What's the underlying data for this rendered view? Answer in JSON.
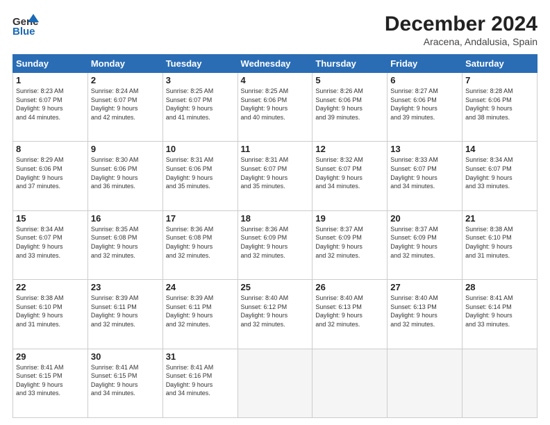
{
  "header": {
    "logo_line1": "General",
    "logo_line2": "Blue",
    "month_year": "December 2024",
    "location": "Aracena, Andalusia, Spain"
  },
  "weekdays": [
    "Sunday",
    "Monday",
    "Tuesday",
    "Wednesday",
    "Thursday",
    "Friday",
    "Saturday"
  ],
  "weeks": [
    [
      {
        "day": 1,
        "lines": [
          "Sunrise: 8:23 AM",
          "Sunset: 6:07 PM",
          "Daylight: 9 hours",
          "and 44 minutes."
        ]
      },
      {
        "day": 2,
        "lines": [
          "Sunrise: 8:24 AM",
          "Sunset: 6:07 PM",
          "Daylight: 9 hours",
          "and 42 minutes."
        ]
      },
      {
        "day": 3,
        "lines": [
          "Sunrise: 8:25 AM",
          "Sunset: 6:07 PM",
          "Daylight: 9 hours",
          "and 41 minutes."
        ]
      },
      {
        "day": 4,
        "lines": [
          "Sunrise: 8:25 AM",
          "Sunset: 6:06 PM",
          "Daylight: 9 hours",
          "and 40 minutes."
        ]
      },
      {
        "day": 5,
        "lines": [
          "Sunrise: 8:26 AM",
          "Sunset: 6:06 PM",
          "Daylight: 9 hours",
          "and 39 minutes."
        ]
      },
      {
        "day": 6,
        "lines": [
          "Sunrise: 8:27 AM",
          "Sunset: 6:06 PM",
          "Daylight: 9 hours",
          "and 39 minutes."
        ]
      },
      {
        "day": 7,
        "lines": [
          "Sunrise: 8:28 AM",
          "Sunset: 6:06 PM",
          "Daylight: 9 hours",
          "and 38 minutes."
        ]
      }
    ],
    [
      {
        "day": 8,
        "lines": [
          "Sunrise: 8:29 AM",
          "Sunset: 6:06 PM",
          "Daylight: 9 hours",
          "and 37 minutes."
        ]
      },
      {
        "day": 9,
        "lines": [
          "Sunrise: 8:30 AM",
          "Sunset: 6:06 PM",
          "Daylight: 9 hours",
          "and 36 minutes."
        ]
      },
      {
        "day": 10,
        "lines": [
          "Sunrise: 8:31 AM",
          "Sunset: 6:06 PM",
          "Daylight: 9 hours",
          "and 35 minutes."
        ]
      },
      {
        "day": 11,
        "lines": [
          "Sunrise: 8:31 AM",
          "Sunset: 6:07 PM",
          "Daylight: 9 hours",
          "and 35 minutes."
        ]
      },
      {
        "day": 12,
        "lines": [
          "Sunrise: 8:32 AM",
          "Sunset: 6:07 PM",
          "Daylight: 9 hours",
          "and 34 minutes."
        ]
      },
      {
        "day": 13,
        "lines": [
          "Sunrise: 8:33 AM",
          "Sunset: 6:07 PM",
          "Daylight: 9 hours",
          "and 34 minutes."
        ]
      },
      {
        "day": 14,
        "lines": [
          "Sunrise: 8:34 AM",
          "Sunset: 6:07 PM",
          "Daylight: 9 hours",
          "and 33 minutes."
        ]
      }
    ],
    [
      {
        "day": 15,
        "lines": [
          "Sunrise: 8:34 AM",
          "Sunset: 6:07 PM",
          "Daylight: 9 hours",
          "and 33 minutes."
        ]
      },
      {
        "day": 16,
        "lines": [
          "Sunrise: 8:35 AM",
          "Sunset: 6:08 PM",
          "Daylight: 9 hours",
          "and 32 minutes."
        ]
      },
      {
        "day": 17,
        "lines": [
          "Sunrise: 8:36 AM",
          "Sunset: 6:08 PM",
          "Daylight: 9 hours",
          "and 32 minutes."
        ]
      },
      {
        "day": 18,
        "lines": [
          "Sunrise: 8:36 AM",
          "Sunset: 6:09 PM",
          "Daylight: 9 hours",
          "and 32 minutes."
        ]
      },
      {
        "day": 19,
        "lines": [
          "Sunrise: 8:37 AM",
          "Sunset: 6:09 PM",
          "Daylight: 9 hours",
          "and 32 minutes."
        ]
      },
      {
        "day": 20,
        "lines": [
          "Sunrise: 8:37 AM",
          "Sunset: 6:09 PM",
          "Daylight: 9 hours",
          "and 32 minutes."
        ]
      },
      {
        "day": 21,
        "lines": [
          "Sunrise: 8:38 AM",
          "Sunset: 6:10 PM",
          "Daylight: 9 hours",
          "and 31 minutes."
        ]
      }
    ],
    [
      {
        "day": 22,
        "lines": [
          "Sunrise: 8:38 AM",
          "Sunset: 6:10 PM",
          "Daylight: 9 hours",
          "and 31 minutes."
        ]
      },
      {
        "day": 23,
        "lines": [
          "Sunrise: 8:39 AM",
          "Sunset: 6:11 PM",
          "Daylight: 9 hours",
          "and 32 minutes."
        ]
      },
      {
        "day": 24,
        "lines": [
          "Sunrise: 8:39 AM",
          "Sunset: 6:11 PM",
          "Daylight: 9 hours",
          "and 32 minutes."
        ]
      },
      {
        "day": 25,
        "lines": [
          "Sunrise: 8:40 AM",
          "Sunset: 6:12 PM",
          "Daylight: 9 hours",
          "and 32 minutes."
        ]
      },
      {
        "day": 26,
        "lines": [
          "Sunrise: 8:40 AM",
          "Sunset: 6:13 PM",
          "Daylight: 9 hours",
          "and 32 minutes."
        ]
      },
      {
        "day": 27,
        "lines": [
          "Sunrise: 8:40 AM",
          "Sunset: 6:13 PM",
          "Daylight: 9 hours",
          "and 32 minutes."
        ]
      },
      {
        "day": 28,
        "lines": [
          "Sunrise: 8:41 AM",
          "Sunset: 6:14 PM",
          "Daylight: 9 hours",
          "and 33 minutes."
        ]
      }
    ],
    [
      {
        "day": 29,
        "lines": [
          "Sunrise: 8:41 AM",
          "Sunset: 6:15 PM",
          "Daylight: 9 hours",
          "and 33 minutes."
        ]
      },
      {
        "day": 30,
        "lines": [
          "Sunrise: 8:41 AM",
          "Sunset: 6:15 PM",
          "Daylight: 9 hours",
          "and 34 minutes."
        ]
      },
      {
        "day": 31,
        "lines": [
          "Sunrise: 8:41 AM",
          "Sunset: 6:16 PM",
          "Daylight: 9 hours",
          "and 34 minutes."
        ]
      },
      null,
      null,
      null,
      null
    ]
  ]
}
